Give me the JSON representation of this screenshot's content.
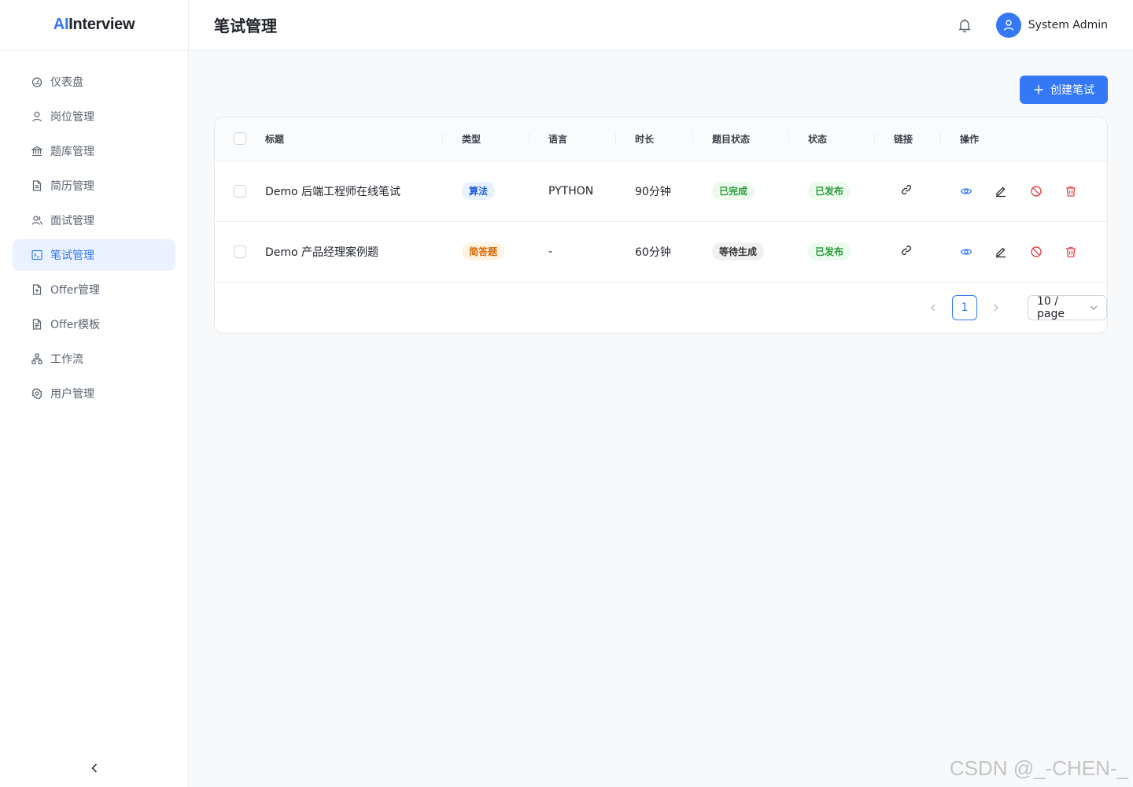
{
  "app": {
    "logo_ai": "AI",
    "logo_rest": "Interview"
  },
  "sidebar": {
    "items": [
      {
        "label": "仪表盘",
        "icon": "dashboard-icon"
      },
      {
        "label": "岗位管理",
        "icon": "user-icon"
      },
      {
        "label": "题库管理",
        "icon": "bank-icon"
      },
      {
        "label": "简历管理",
        "icon": "file-icon"
      },
      {
        "label": "面试管理",
        "icon": "team-icon"
      },
      {
        "label": "笔试管理",
        "icon": "terminal-icon",
        "active": true
      },
      {
        "label": "Offer管理",
        "icon": "file-add-icon"
      },
      {
        "label": "Offer模板",
        "icon": "file-text-icon"
      },
      {
        "label": "工作流",
        "icon": "cluster-icon"
      },
      {
        "label": "用户管理",
        "icon": "gear-icon"
      }
    ]
  },
  "header": {
    "title": "笔试管理",
    "username": "System Admin"
  },
  "toolbar": {
    "create_label": "创建笔试"
  },
  "table": {
    "columns": [
      "标题",
      "类型",
      "语言",
      "时长",
      "题目状态",
      "状态",
      "链接",
      "操作"
    ],
    "rows": [
      {
        "title": "Demo 后端工程师在线笔试",
        "type": "算法",
        "language": "PYTHON",
        "duration": "90分钟",
        "question_status": "已完成",
        "status": "已发布"
      },
      {
        "title": "Demo 产品经理案例题",
        "type": "简答题",
        "language": "-",
        "duration": "60分钟",
        "question_status": "等待生成",
        "status": "已发布"
      }
    ]
  },
  "pagination": {
    "current": "1",
    "page_size": "10 / page"
  },
  "watermark": "CSDN @_-CHEN-_",
  "colors": {
    "accent": "#3478f6",
    "danger": "#e5484d"
  }
}
